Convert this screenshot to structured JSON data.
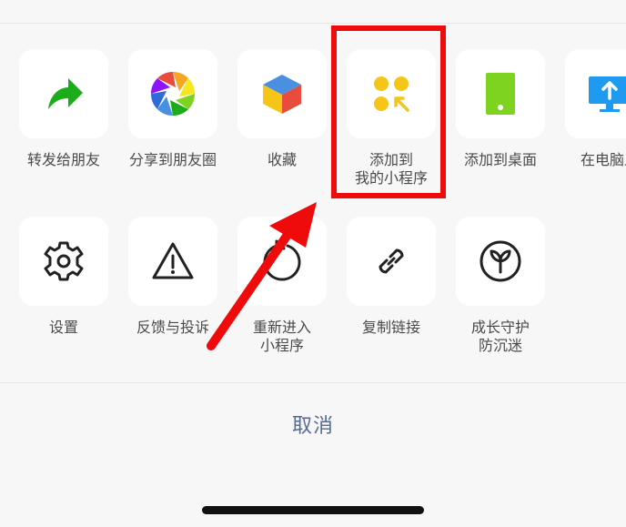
{
  "share_row": [
    {
      "label": "转发给朋友",
      "icon": "forward-arrow-icon"
    },
    {
      "label": "分享到朋友圈",
      "icon": "moments-aperture-icon"
    },
    {
      "label": "收藏",
      "icon": "favorites-cube-icon"
    },
    {
      "label": "添加到\n我的小程序",
      "icon": "add-to-my-miniprogram-icon"
    },
    {
      "label": "添加到桌面",
      "icon": "phone-desktop-icon"
    },
    {
      "label": "在电脑上",
      "icon": "open-on-computer-icon"
    }
  ],
  "action_row": [
    {
      "label": "设置",
      "icon": "gear-icon"
    },
    {
      "label": "反馈与投诉",
      "icon": "warning-triangle-icon"
    },
    {
      "label": "重新进入\n小程序",
      "icon": "reload-icon"
    },
    {
      "label": "复制链接",
      "icon": "link-icon"
    },
    {
      "label": "成长守护\n防沉迷",
      "icon": "sprout-icon"
    }
  ],
  "cancel_label": "取消",
  "colors": {
    "accent": "#576b95",
    "highlight": "#ef0b0b",
    "wechat_green": "#1aad19",
    "miniprogram_yellow": "#f5c518",
    "desktop_green": "#7ed321",
    "computer_blue": "#1e9bf0"
  }
}
